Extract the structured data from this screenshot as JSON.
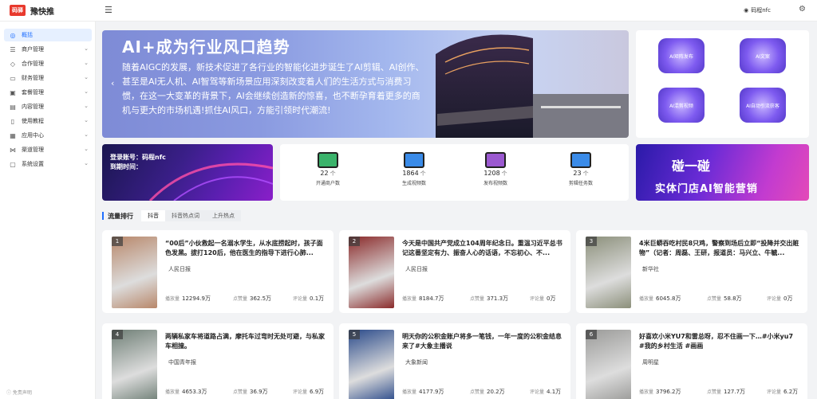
{
  "brand": {
    "logo_text": "码驿",
    "name": "豫快推"
  },
  "header": {
    "user": "码程nfc"
  },
  "sidebar": {
    "items": [
      {
        "label": "概括",
        "icon": "dashboard-icon",
        "active": true,
        "expand": false
      },
      {
        "label": "商户管理",
        "icon": "list-icon",
        "expand": true
      },
      {
        "label": "合作管理",
        "icon": "handshake-icon",
        "expand": true
      },
      {
        "label": "财务管理",
        "icon": "wallet-icon",
        "expand": true
      },
      {
        "label": "套餐管理",
        "icon": "package-icon",
        "expand": true
      },
      {
        "label": "内容管理",
        "icon": "content-icon",
        "expand": true
      },
      {
        "label": "使用教程",
        "icon": "book-icon",
        "expand": true
      },
      {
        "label": "应用中心",
        "icon": "app-icon",
        "expand": true
      },
      {
        "label": "渠道管理",
        "icon": "channel-icon",
        "expand": true
      },
      {
        "label": "系统设置",
        "icon": "settings-icon",
        "expand": true
      }
    ],
    "footer": "免责声明"
  },
  "banner": {
    "title": "AI+成为行业风口趋势",
    "text": "随着AIGC的发展，新技术促进了各行业的智能化进步诞生了AI剪辑、AI创作、甚至是AI无人机、AI智驾等新场景应用深刻改变着人们的生活方式与消费习惯，在这一大变革的背景下，AI会继续创造新的惊喜，也不断孕育着更多的商机与更大的市场机遇!抓住AI风口，方能引领时代潮流!"
  },
  "tiles": [
    "AI矩阵发布",
    "AI文案",
    "AI混剪视频",
    "AI自动引流获客"
  ],
  "account": {
    "label1": "登录账号：码程nfc",
    "label2": "到期时间："
  },
  "stats": [
    {
      "value": "22",
      "unit": "个",
      "label": "开通商户数",
      "color": "#3bb36b"
    },
    {
      "value": "1864",
      "unit": "个",
      "label": "生成视频数",
      "color": "#3a8be8"
    },
    {
      "value": "1208",
      "unit": "个",
      "label": "发布视频数",
      "color": "#9b59d0"
    },
    {
      "value": "23",
      "unit": "个",
      "label": "剪辑任务数",
      "color": "#3a8be8"
    }
  ],
  "ad": {
    "line1": "碰一碰",
    "line2": "实体门店AI智能营销"
  },
  "section": {
    "title": "流量排行",
    "tabs": [
      "抖音",
      "抖音热点词",
      "上升热点"
    ]
  },
  "meta_labels": {
    "play": "播放量",
    "like": "点赞量",
    "comment": "评论量"
  },
  "cards": [
    {
      "rank": "1",
      "title": "“00后”小伙救起一名溺水学生，从水底捞起时，孩子面色发黑。拔打120后，他在医生的指导下进行心肺...",
      "source": "人民日报",
      "play": "12294.9万",
      "like": "362.5万",
      "comment": "0.1万",
      "img": "#b8876a"
    },
    {
      "rank": "2",
      "title": "今天是中国共产党成立104周年纪念日。重温习近平总书记这番坚定有力、振奋人心的话语，不忘初心、不...",
      "source": "人民日报",
      "play": "8184.7万",
      "like": "371.3万",
      "comment": "0万",
      "img": "#8a2a2a"
    },
    {
      "rank": "3",
      "title": "4米巨蟒吞吃村民8只鸡，警察到场后立即“投降并交出赃物”（记者：周磊、王研，报道员：马兴立、牛毓...",
      "source": "新华社",
      "play": "6045.8万",
      "like": "58.8万",
      "comment": "0万",
      "img": "#8b8f7a"
    },
    {
      "rank": "4",
      "title": "两辆私家车将道路占满，摩托车过弯时无处可避，与私家车相撞。",
      "source": "中国青年报",
      "play": "4653.3万",
      "like": "36.9万",
      "comment": "6.9万",
      "img": "#6f7f76"
    },
    {
      "rank": "5",
      "title": "明天你的公积金账户将多一笔钱，一年一度的公积金结息来了#大象主播说",
      "source": "大象新闻",
      "play": "4177.9万",
      "like": "20.2万",
      "comment": "4.1万",
      "img": "#2a4a8a"
    },
    {
      "rank": "6",
      "title": "好喜欢小米YU7和雷总呀，忍不住画一下…#小米yu7 #我的乡村生活 #画画",
      "source": "周明星",
      "play": "3796.2万",
      "like": "127.7万",
      "comment": "6.2万",
      "img": "#9a9a98"
    }
  ]
}
